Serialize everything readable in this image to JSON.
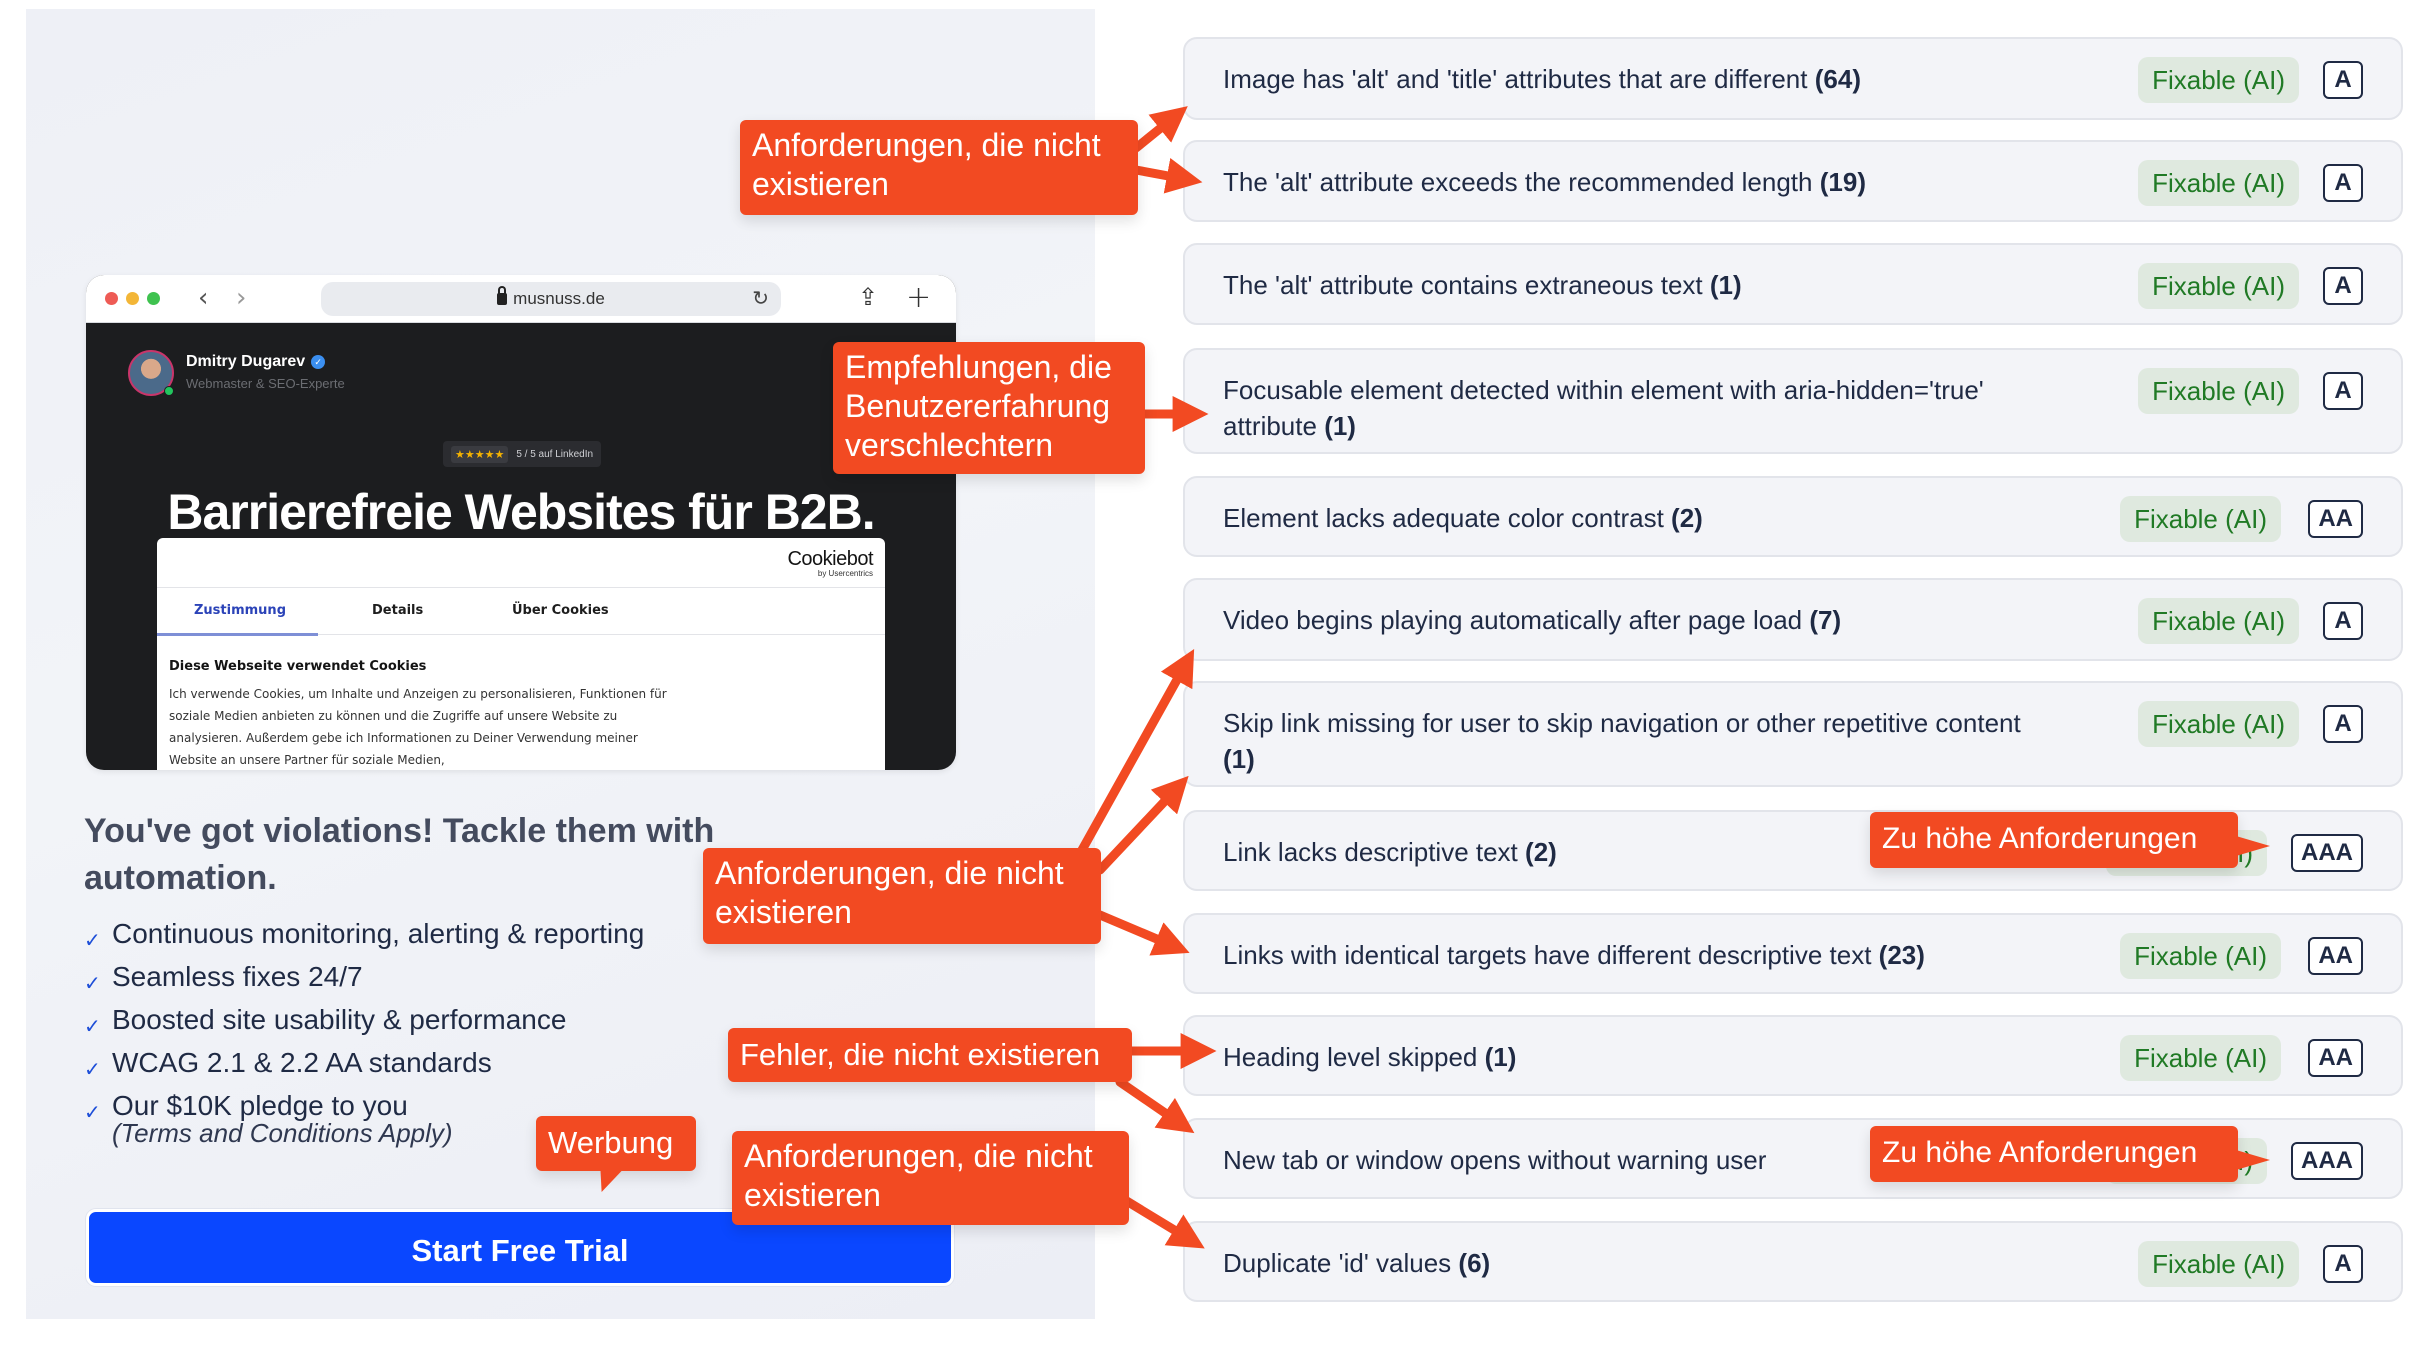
{
  "promo": {
    "browser": {
      "url": "musnuss.de",
      "author_name": "Dmitry Dugarev",
      "author_role": "Webmaster & SEO-Experte",
      "rating_stars": "★★★★★",
      "rating_text": "5 / 5 auf LinkedIn",
      "hero_title": "Barrierefreie Websites für B2B.",
      "cookie_logo": "Cookiebot",
      "cookie_logo_sub": "by Usercentrics",
      "cookie_tabs": [
        "Zustimmung",
        "Details",
        "Über Cookies"
      ],
      "cookie_heading": "Diese Webseite verwendet Cookies",
      "cookie_body": "Ich verwende Cookies, um Inhalte und Anzeigen zu personalisieren, Funktionen für soziale Medien anbieten zu können und die Zugriffe auf unsere Website zu analysieren. Außerdem gebe ich Informationen zu Deiner Verwendung meiner Website an unsere Partner für soziale Medien,"
    },
    "heading": "You've got violations! Tackle them with automation.",
    "features": [
      "Continuous monitoring, alerting & reporting",
      "Seamless fixes 24/7",
      "Boosted site usability & performance",
      "WCAG 2.1 & 2.2 AA standards",
      "Our $10K pledge to you"
    ],
    "feature_note": "(Terms and Conditions Apply)",
    "cta_label": "Start Free Trial"
  },
  "violations": [
    {
      "text": "Image has 'alt' and 'title' attributes that are different",
      "count": "(64)",
      "fixable": "Fixable (AI)",
      "level": "A"
    },
    {
      "text": "The 'alt' attribute exceeds the recommended length",
      "count": "(19)",
      "fixable": "Fixable (AI)",
      "level": "A"
    },
    {
      "text": "The 'alt' attribute contains extraneous text",
      "count": "(1)",
      "fixable": "Fixable (AI)",
      "level": "A"
    },
    {
      "text": "Focusable element detected within element with aria-hidden='true' attribute",
      "count": "(1)",
      "fixable": "Fixable (AI)",
      "level": "A"
    },
    {
      "text": "Element lacks adequate color contrast",
      "count": "(2)",
      "fixable": "Fixable (AI)",
      "level": "AA"
    },
    {
      "text": "Video begins playing automatically after page load",
      "count": "(7)",
      "fixable": "Fixable (AI)",
      "level": "A"
    },
    {
      "text": "Skip link missing for user to skip navigation or other repetitive content",
      "count": "(1)",
      "fixable": "Fixable (AI)",
      "level": "A"
    },
    {
      "text": "Link lacks descriptive text",
      "count": "(2)",
      "fixable": "Fixable (AI)",
      "level": "AAA"
    },
    {
      "text": "Links with identical targets have different descriptive text",
      "count": "(23)",
      "fixable": "Fixable (AI)",
      "level": "AA"
    },
    {
      "text": "Heading level skipped",
      "count": "(1)",
      "fixable": "Fixable (AI)",
      "level": "AA"
    },
    {
      "text": "New tab or window opens without warning user",
      "count": "",
      "fixable": "Fixable (AI)",
      "level": "AAA"
    },
    {
      "text": "Duplicate 'id' values",
      "count": "(6)",
      "fixable": "Fixable (AI)",
      "level": "A"
    }
  ],
  "annotations": {
    "nonexistent_requirements": "Anforderungen, die nicht existieren",
    "ux_worsening": "Empfehlungen, die Benutzererfahrung verschlechtern",
    "nonexistent_errors": "Fehler, die nicht existieren",
    "advertising": "Werbung",
    "too_high_requirements": "Zu höhe Anforderungen"
  },
  "colors": {
    "annotation": "#f24a22",
    "cta": "#0a47ff",
    "fixable_bg": "#dfe9df",
    "fixable_text": "#207a25"
  }
}
